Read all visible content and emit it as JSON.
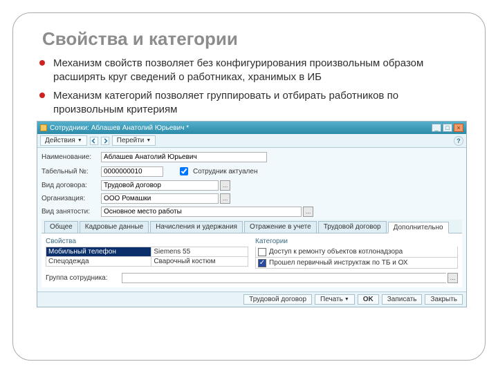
{
  "slide": {
    "title": "Свойства и категории",
    "bullets": [
      "Механизм свойств позволяет без конфигурирования произвольным образом расширять круг сведений о работниках, хранимых в ИБ",
      "Механизм категорий позволяет группировать и отбирать работников по произвольным критериям"
    ]
  },
  "window": {
    "title": "Сотрудники: Аблашев Анатолий Юрьевич *"
  },
  "toolbar": {
    "actions": "Действия",
    "go": "Перейти",
    "help": "?"
  },
  "form": {
    "name_label": "Наименование:",
    "name_value": "Аблашев Анатолий Юрьевич",
    "tabnum_label": "Табельный №:",
    "tabnum_value": "0000000010",
    "actual_label": "Сотрудник актуален",
    "actual_checked": true,
    "contract_label": "Вид договора:",
    "contract_value": "Трудовой договор",
    "org_label": "Организация:",
    "org_value": "ООО Ромашки",
    "employment_label": "Вид занятости:",
    "employment_value": "Основное место работы",
    "group_label": "Группа сотрудника:",
    "group_value": ""
  },
  "tabs": [
    "Общее",
    "Кадровые данные",
    "Начисления и удержания",
    "Отражение в учете",
    "Трудовой договор",
    "Дополнительно"
  ],
  "tab_active_index": 5,
  "props": {
    "title": "Свойства",
    "rows": [
      {
        "name": "Мобильный телефон",
        "value": "Siemens 55"
      },
      {
        "name": "Спецодежда",
        "value": "Сварочный костюм"
      }
    ],
    "selected_index": 0
  },
  "cats": {
    "title": "Категории",
    "rows": [
      {
        "checked": false,
        "label": "Доступ к ремонту объектов котлонадзора"
      },
      {
        "checked": true,
        "label": "Прошел первичный инструктаж по ТБ и ОХ"
      }
    ]
  },
  "statusbar": {
    "contract_link": "Трудовой договор",
    "print": "Печать",
    "ok": "OK",
    "save": "Записать",
    "close": "Закрыть"
  }
}
